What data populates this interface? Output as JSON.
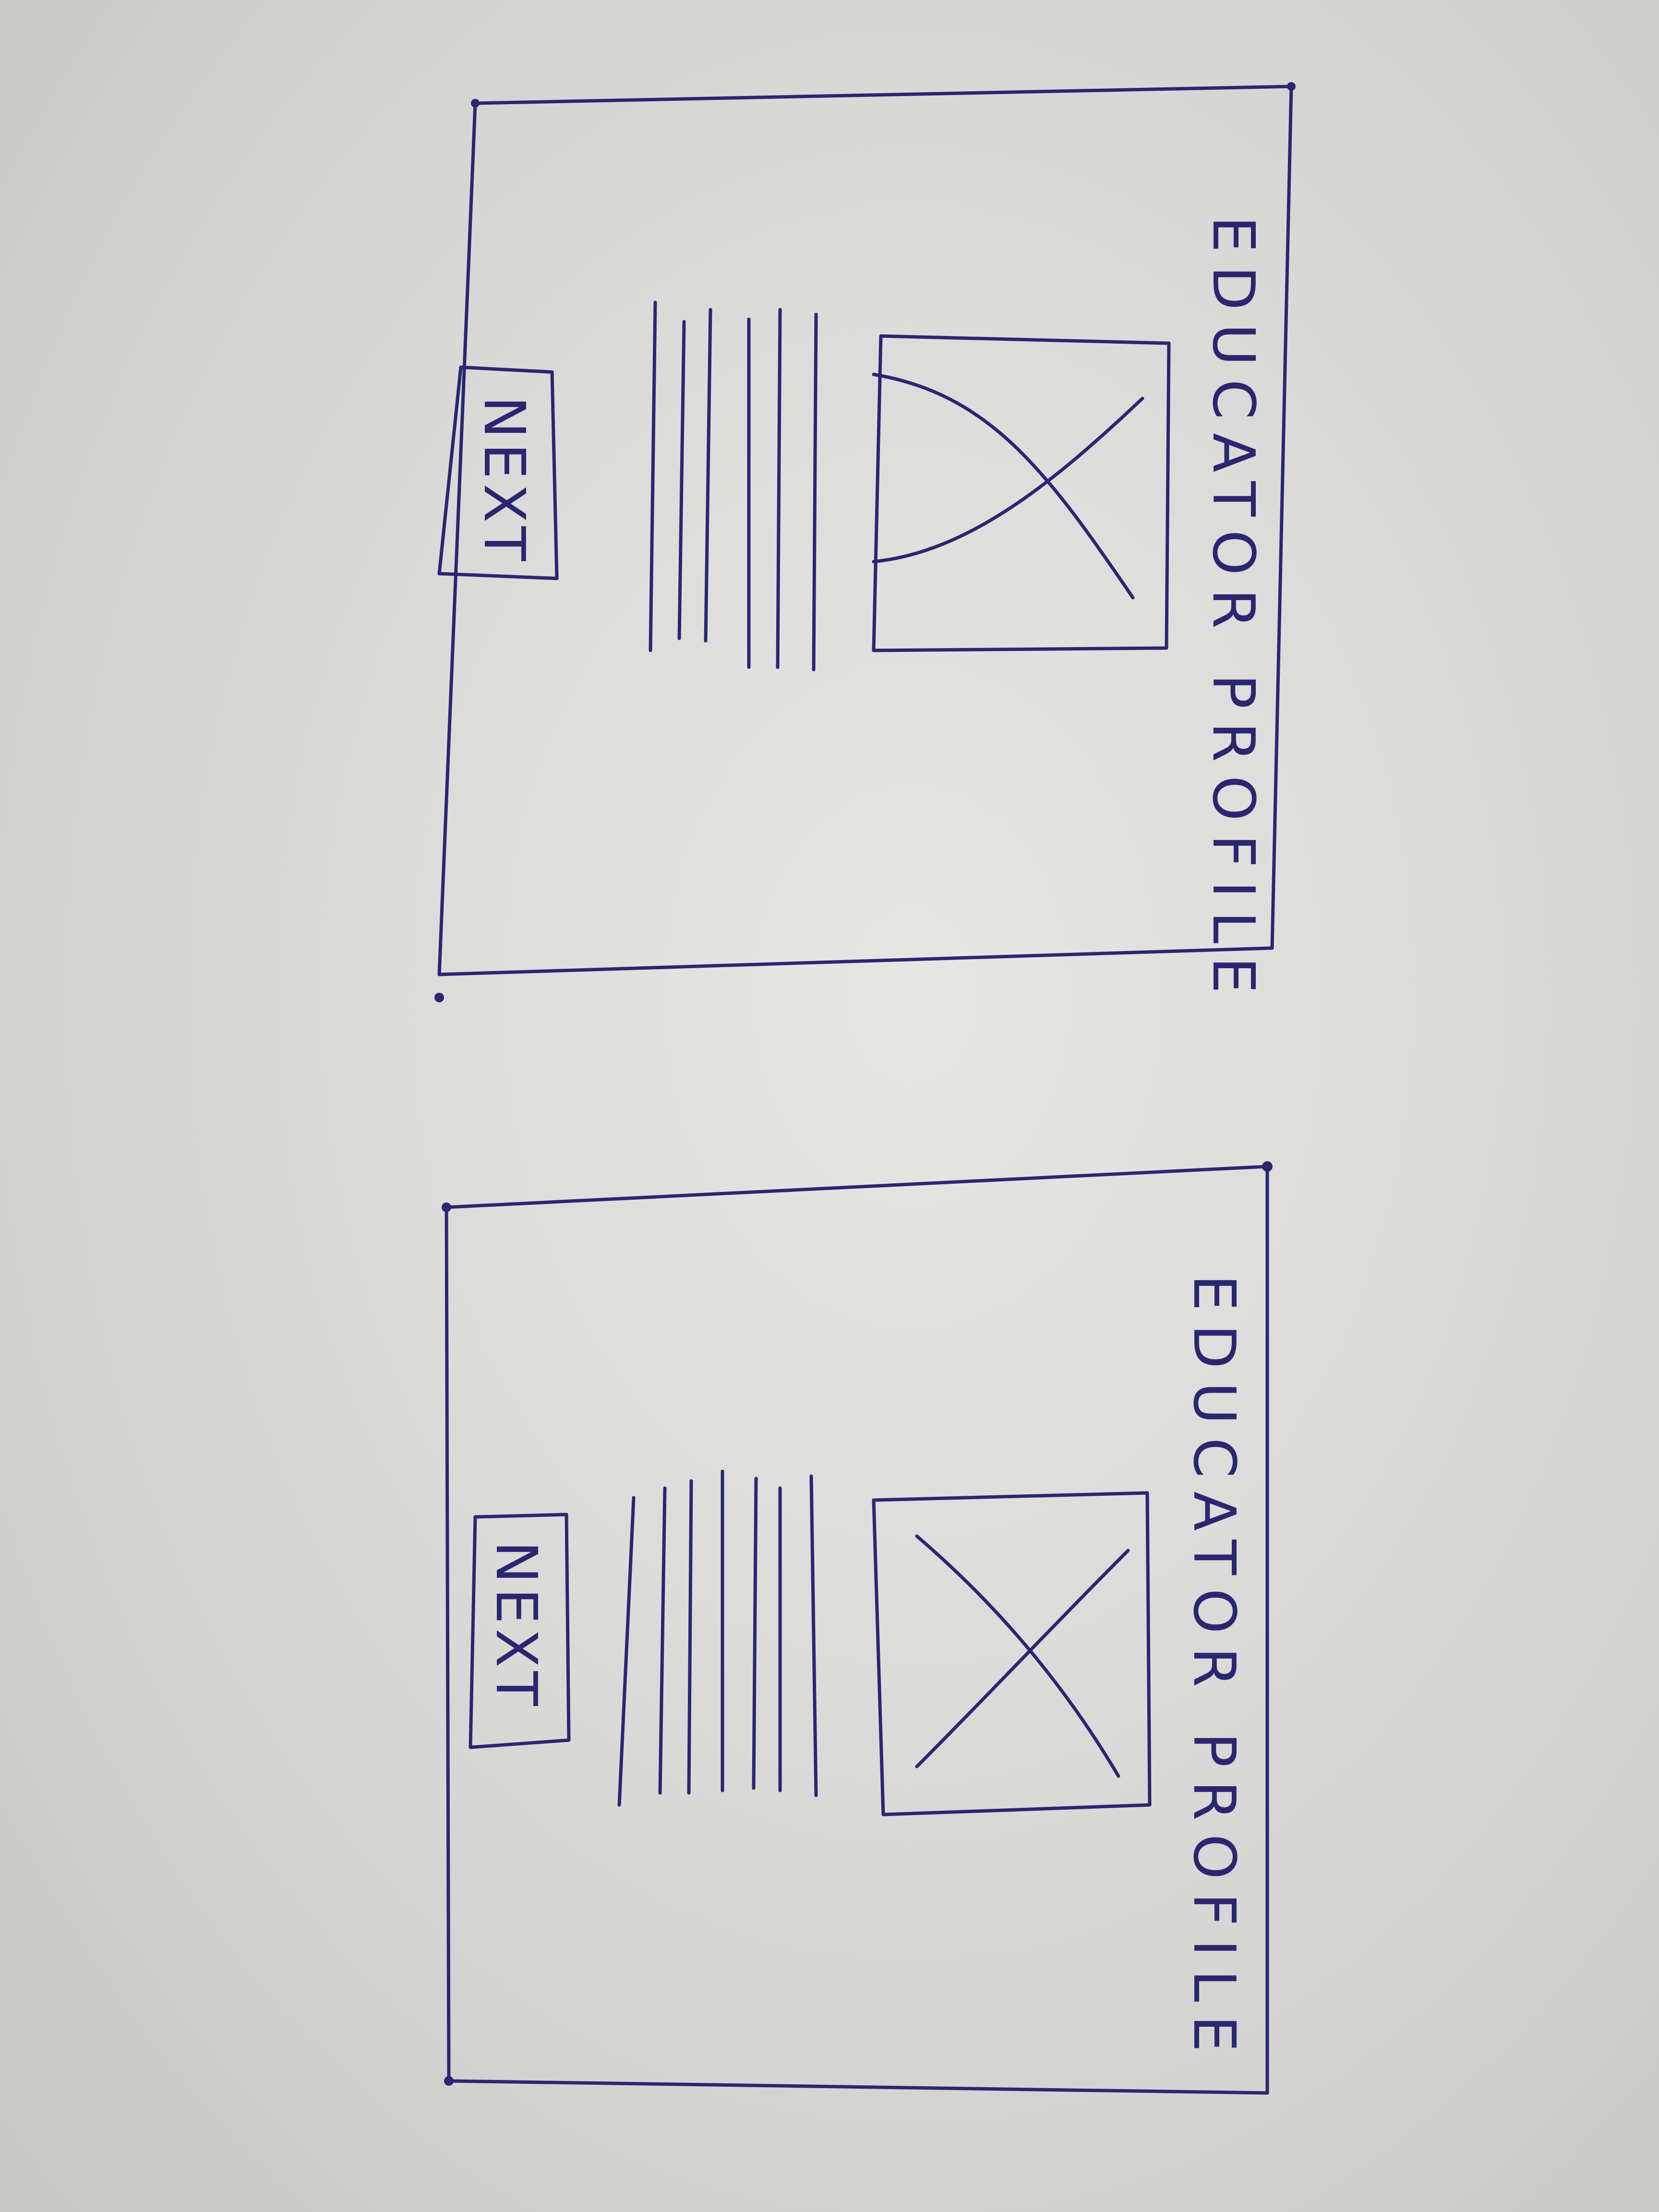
{
  "screens": [
    {
      "title": "EDUCATOR PROFILE",
      "image_placeholder": "image-placeholder",
      "text_lines": 6,
      "button_label": "NEXT"
    },
    {
      "title": "EDUCATOR PROFILE",
      "image_placeholder": "image-placeholder",
      "text_lines": 7,
      "button_label": "NEXT"
    }
  ],
  "colors": {
    "ink": "#2b2670",
    "paper": "#dcdcda"
  }
}
